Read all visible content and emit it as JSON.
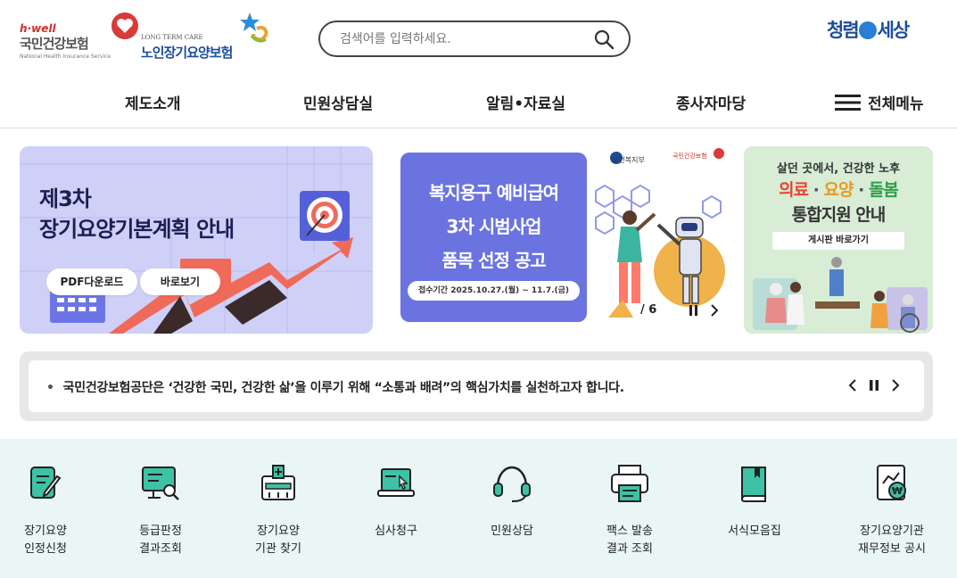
{
  "header": {
    "nhis_logo": {
      "tag": "h·well",
      "name": "국민건강보험",
      "en": "National Health Insurance Service"
    },
    "ltc_logo": {
      "en": "LONG TERM CARE",
      "name": "노인장기요양보험"
    },
    "search": {
      "placeholder": "검색어를 입력하세요."
    },
    "slogan": {
      "left": "청렴",
      "right": "세상"
    }
  },
  "gnb": {
    "items": [
      "제도소개",
      "민원상담실",
      "알림•자료실",
      "종사자마당"
    ],
    "all_menu": "전체메뉴"
  },
  "banners": {
    "b1": {
      "title_1": "제3차",
      "title_2": "장기요양기본계획 안내",
      "btn_pdf": "PDF다운로드",
      "btn_view": "바로보기"
    },
    "b2": {
      "title_1": "복지용구 예비급여",
      "title_2": "3차 시범사업",
      "title_3": "품목 선정 공고",
      "date": "접수기간  2025.10.27.(월) ~ 11.7.(금)",
      "org_1": "보건복지부",
      "org_2": "국민건강보험",
      "pager": "/ 6"
    },
    "b3": {
      "line_1": "살던 곳에서, 건강한 노후",
      "line_2a": "의료",
      "line_2b": "요양",
      "line_2c": "돌봄",
      "line_3": "통합지원 안내",
      "btn": "게시판 바로가기"
    }
  },
  "notice": {
    "text": "국민건강보험공단은 ‘건강한 국민, 건강한 삶’을 이루기 위해 “소통과 배려”의 핵심가치를 실천하고자 합니다."
  },
  "quick_menu": [
    {
      "icon": "document-pen-icon",
      "line1": "장기요양",
      "line2": "인정신청"
    },
    {
      "icon": "monitor-search-icon",
      "line1": "등급판정",
      "line2": "결과조회"
    },
    {
      "icon": "hospital-icon",
      "line1": "장기요양",
      "line2": "기관 찾기"
    },
    {
      "icon": "laptop-cursor-icon",
      "line1": "심사청구",
      "line2": ""
    },
    {
      "icon": "headset-icon",
      "line1": "민원상담",
      "line2": ""
    },
    {
      "icon": "printer-icon",
      "line1": "팩스 발송",
      "line2": "결과 조회"
    },
    {
      "icon": "book-icon",
      "line1": "서식모음집",
      "line2": ""
    },
    {
      "icon": "finance-document-icon",
      "line1": "장기요양기관",
      "line2": "재무정보 공시"
    }
  ],
  "colors": {
    "brand_blue": "#1b4d9c",
    "accent_red": "#c9302c",
    "quick_bg": "#eaf5f5",
    "icon_teal": "#3ec2a5"
  }
}
